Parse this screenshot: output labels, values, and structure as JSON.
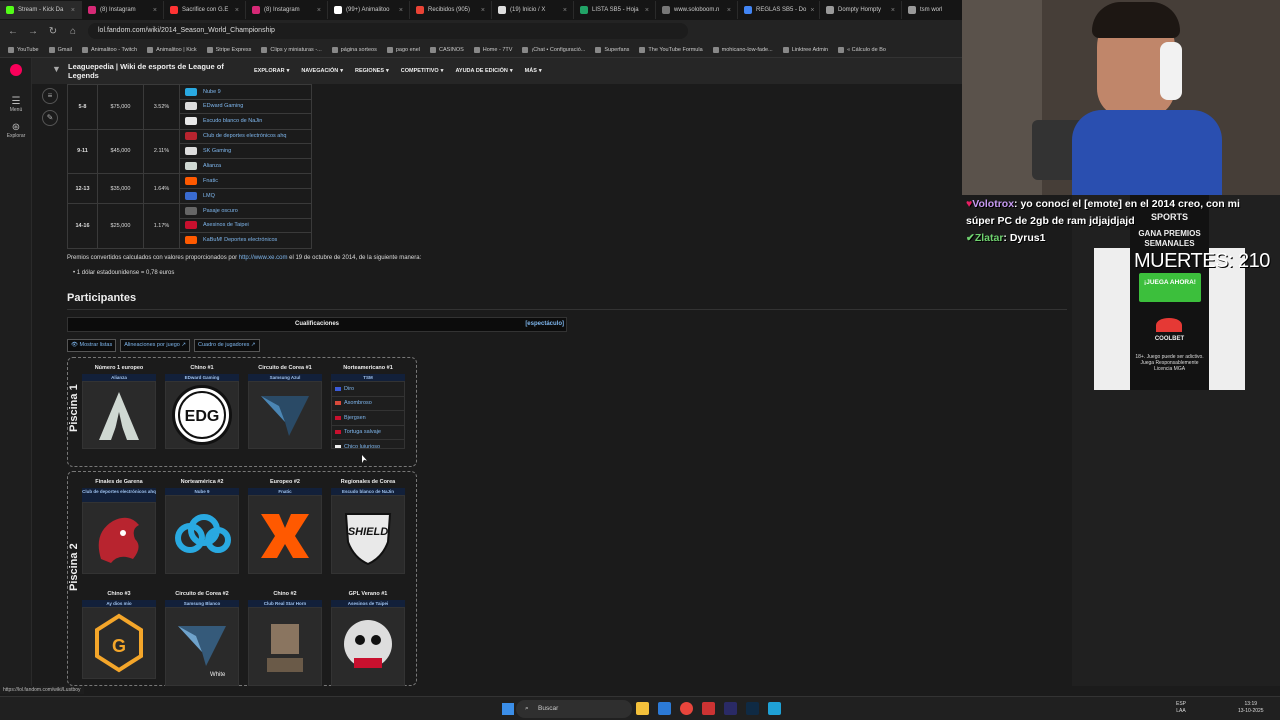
{
  "browser": {
    "tabs": [
      {
        "label": "Stream - Kick Da",
        "color": "#53fc18"
      },
      {
        "label": "(8) Instagram",
        "color": "#d62976"
      },
      {
        "label": "Sacrifice con G.E",
        "color": "#ff3333"
      },
      {
        "label": "(8) Instagram",
        "color": "#d62976"
      },
      {
        "label": "(99+) Animalitoo",
        "color": "#ffffff"
      },
      {
        "label": "Recibidos (905)",
        "color": "#ea4335"
      },
      {
        "label": "(19) Inicio / X",
        "color": "#dddddd"
      },
      {
        "label": "LISTA SB5 - Hoja",
        "color": "#21a366"
      },
      {
        "label": "www.soloboom.n",
        "color": "#777777"
      },
      {
        "label": "REGLAS SB5 - Do",
        "color": "#4285f4"
      },
      {
        "label": "Dompty Hompty",
        "color": "#999999"
      },
      {
        "label": "tsm worl",
        "color": "#999999"
      }
    ],
    "url": "lol.fandom.com/wiki/2014_Season_World_Championship",
    "bookmarks": [
      "YouTube",
      "Gmail",
      "Animalitoo - Twitch",
      "Animalitoo | Kick",
      "Stripe Express",
      "Clips y miniaturas -...",
      "página sorteos",
      "pago enel",
      "CASINOS",
      "Home - 7TV",
      "¡Chat • Configuració...",
      "Superfans",
      "The YouTube Formula",
      "mohicano-low-fade...",
      "Linktree Admin",
      "« Cálculo de Bo"
    ],
    "status_url": "https://lol.fandom.com/wiki/Lustboy"
  },
  "rail": {
    "menu": "Menú",
    "explore": "Explorar"
  },
  "wiki": {
    "title": "Leaguepedia | Wiki de esports de League of Legends",
    "menu": [
      "EXPLORAR",
      "NAVEGACIÓN",
      "REGIONES",
      "COMPETITIVO",
      "AYUDA DE EDICIÓN",
      "MÁS"
    ]
  },
  "prize_table": {
    "rows": [
      {
        "place": "5-8",
        "amount": "$75,000",
        "pct": "3.52%",
        "teams": [
          "Nube 9",
          "EDward Gaming",
          "Escudo blanco de NaJin"
        ]
      },
      {
        "place": "9-11",
        "amount": "$45,000",
        "pct": "2.11%",
        "teams": [
          "Club de deportes electrónicos ahq",
          "SK Gaming",
          "Alianza"
        ]
      },
      {
        "place": "12-13",
        "amount": "$35,000",
        "pct": "1.64%",
        "teams": [
          "Fnatic",
          "LMQ"
        ]
      },
      {
        "place": "14-16",
        "amount": "$25,000",
        "pct": "1.17%",
        "teams": [
          "Pasaje oscuro",
          "Asesinos de Taipei",
          "KaBuM! Deportes electrónicos"
        ]
      }
    ]
  },
  "notes": {
    "conversion_pre": "Premios convertidos calculados con valores proporcionados por ",
    "conversion_link": "http://www.xe.com",
    "conversion_post": " el 19 de octubre de 2014, de la siguiente manera:",
    "bullet": "1 dólar estadounidense = 0,78 euros"
  },
  "participants": {
    "heading": "Participantes",
    "qual_title": "Cualificaciones",
    "show_link": "[espectáculo]",
    "buttons": [
      "Mostrar listas",
      "Alineaciones por juego",
      "Cuadro de jugadores"
    ],
    "pool1": {
      "label": "Piscina 1",
      "slots": [
        {
          "seed": "Número 1 europeo",
          "team": "Alianza"
        },
        {
          "seed": "Chino #1",
          "team": "EDward Gaming"
        },
        {
          "seed": "Circuito de Corea #1",
          "team": "Samsung Azul"
        },
        {
          "seed": "Norteamericano #1",
          "team": "TSM"
        }
      ],
      "roster": [
        "Diro",
        "Asombroso",
        "Bjergsen",
        "Tortuga salvaje",
        "Chico lujurioso"
      ]
    },
    "pool2": {
      "label": "Piscina 2",
      "slots": [
        {
          "seed": "Finales de Garena",
          "team": "Club de deportes electrónicos ahq"
        },
        {
          "seed": "Norteamérica #2",
          "team": "Nube 9"
        },
        {
          "seed": "Europeo #2",
          "team": "Fnatic"
        },
        {
          "seed": "Regionales de Corea",
          "team": "Escudo blanco de NaJin"
        },
        {
          "seed": "Chino #3",
          "team": "Ay dios mío"
        },
        {
          "seed": "Circuito de Corea #2",
          "team": "Samsung Blanco"
        },
        {
          "seed": "Chino #2",
          "team": "Club Real Star Horn"
        },
        {
          "seed": "GPL Verano #1",
          "team": "Asesinos de Taipei"
        }
      ]
    }
  },
  "logo_text": {
    "edg": "EDG",
    "shield": "SHIELD",
    "white": "White"
  },
  "ad": {
    "top": "SPORTS",
    "headline": "GANA PREMIOS SEMANALES",
    "cta": "¡JUEGA AHORA!",
    "brand": "COOLBET",
    "fine": "18+. Juego puede ser adictivo. Juega Responsablemente Licencia MGA"
  },
  "overlay": {
    "big": "MUERTES: 210",
    "chat": [
      {
        "user": "Volotrox",
        "msg": " yo conocí el [emote] en el 2014 creo, con mi súper PC de 2gb de ram jdjajdjajd"
      },
      {
        "user": "Zlatar",
        "msg": " Dyrus1"
      }
    ]
  },
  "taskbar": {
    "search": "Buscar",
    "lang": "ESP",
    "lang2": "LAA",
    "time": "13:19",
    "date": "13-10-2025"
  },
  "colors": {
    "link": "#7fb7ee",
    "bg": "#1b1b1b",
    "accent": "#53fc18"
  }
}
